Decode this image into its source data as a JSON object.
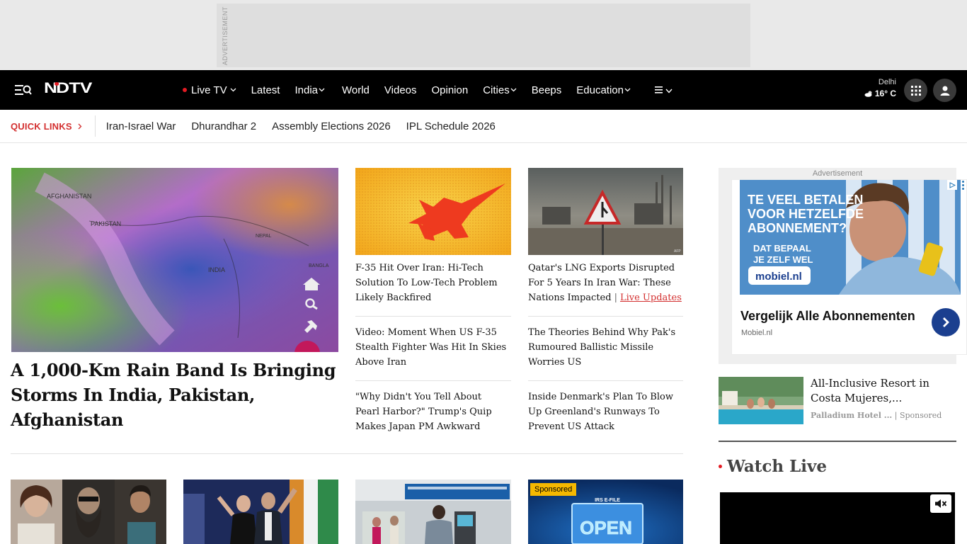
{
  "top_ad": {
    "label": "ADVERTISEMENT"
  },
  "navbar": {
    "logo": "NDTV",
    "items": [
      {
        "label": "Live TV",
        "has_dot": true,
        "has_chevron": true
      },
      {
        "label": "Latest"
      },
      {
        "label": "India",
        "has_chevron": true
      },
      {
        "label": "World"
      },
      {
        "label": "Videos"
      },
      {
        "label": "Opinion"
      },
      {
        "label": "Cities",
        "has_chevron": true
      },
      {
        "label": "Beeps"
      },
      {
        "label": "Education",
        "has_chevron": true
      }
    ],
    "weather": {
      "city": "Delhi",
      "temp": "16° C"
    }
  },
  "quick_links": {
    "label": "QUICK LINKS",
    "items": [
      "Iran-Israel War",
      "Dhurandhar 2",
      "Assembly Elections 2026",
      "IPL Schedule 2026"
    ]
  },
  "hero": {
    "title": "A 1,000-Km Rain Band Is Bringing Storms In India, Pakistan, Afghanistan",
    "map_labels": [
      "AFGHANISTAN",
      "PAKISTAN",
      "NEPAL",
      "INDIA",
      "BANGLA"
    ]
  },
  "stories": {
    "col1": [
      "F-35 Hit Over Iran: Hi-Tech Solution To Low-Tech Problem Likely Backfired",
      "Video: Moment When US F-35 Stealth Fighter Was Hit In Skies Above Iran",
      "\"Why Didn't You Tell About Pearl Harbor?\" Trump's Quip Makes Japan PM Awkward"
    ],
    "col2": [
      "Qatar's LNG Exports Disrupted For 5 Years In Iran War: These Nations Impacted",
      "The Theories Behind Why Pak's Rumoured Ballistic Missile Worries US",
      "Inside Denmark's Plan To Blow Up Greenland's Runways To Prevent US Attack"
    ],
    "live_updates_label": "Live Updates",
    "image_credit": "AFP"
  },
  "right_ad": {
    "label": "Advertisement",
    "creative_lines": [
      "TE VEEL BETALEN",
      "VOOR HETZELFDE",
      "ABONNEMENT?"
    ],
    "creative_sub": [
      "DAT BEPAAL",
      "JE ZELF WEL"
    ],
    "brand": "mobiel.nl",
    "headline": "Vergelijk Alle Abonnementen",
    "domain": "Mobiel.nl"
  },
  "sponsored_story": {
    "title": "All-Inclusive Resort in Costa Mujeres,...",
    "source": "Palladium Hotel ...",
    "tag": "Sponsored"
  },
  "watch_live": {
    "title": "Watch Live"
  },
  "bottom": {
    "sponsored_badge": "Sponsored",
    "irs_text": "IRS E-FILE",
    "open_text": "OPEN"
  },
  "colors": {
    "accent_red": "#e31b23",
    "navbar_bg": "#000000",
    "ad_arrow": "#1b3f8f"
  }
}
